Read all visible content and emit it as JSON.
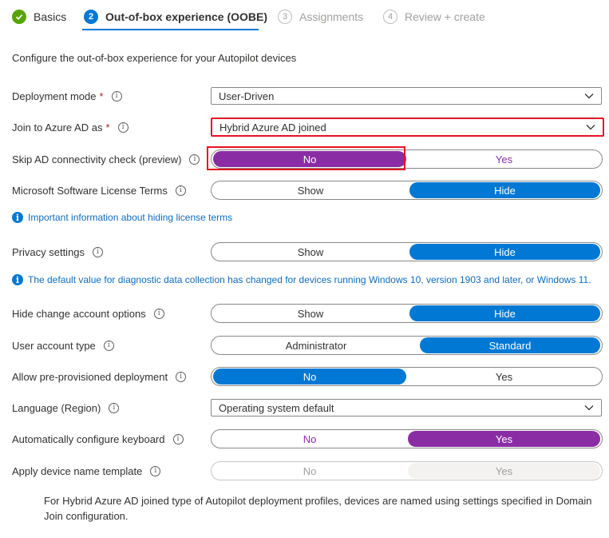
{
  "wizard": {
    "steps": [
      {
        "label": "Basics",
        "state": "done",
        "icon": "check-icon"
      },
      {
        "number": "2",
        "label": "Out-of-box experience (OOBE)",
        "state": "current"
      },
      {
        "number": "3",
        "label": "Assignments",
        "state": "todo"
      },
      {
        "number": "4",
        "label": "Review + create",
        "state": "todo"
      }
    ]
  },
  "intro": "Configure the out-of-box experience for your Autopilot devices",
  "fields": {
    "deployment_mode": {
      "label": "Deployment mode",
      "required": "*",
      "value": "User-Driven"
    },
    "join_azure": {
      "label": "Join to Azure AD as",
      "required": "*",
      "value": "Hybrid Azure AD joined"
    },
    "skip_ad": {
      "label": "Skip AD connectivity check (preview)",
      "options": [
        "No",
        "Yes"
      ],
      "selected": "No"
    },
    "license_terms": {
      "label": "Microsoft Software License Terms",
      "options": [
        "Show",
        "Hide"
      ],
      "selected": "Hide"
    },
    "license_notice": "Important information about hiding license terms",
    "privacy": {
      "label": "Privacy settings",
      "options": [
        "Show",
        "Hide"
      ],
      "selected": "Hide"
    },
    "privacy_notice": "The default value for diagnostic data collection has changed for devices running Windows 10, version 1903 and later, or Windows 11.",
    "change_account": {
      "label": "Hide change account options",
      "options": [
        "Show",
        "Hide"
      ],
      "selected": "Hide"
    },
    "account_type": {
      "label": "User account type",
      "options": [
        "Administrator",
        "Standard"
      ],
      "selected": "Standard"
    },
    "pre_provisioned": {
      "label": "Allow pre-provisioned deployment",
      "options": [
        "No",
        "Yes"
      ],
      "selected": "No"
    },
    "language": {
      "label": "Language (Region)",
      "value": "Operating system default"
    },
    "keyboard": {
      "label": "Automatically configure keyboard",
      "options": [
        "No",
        "Yes"
      ],
      "selected": "Yes"
    },
    "device_name": {
      "label": "Apply device name template",
      "options": [
        "No",
        "Yes"
      ],
      "selected": "Yes",
      "disabled": true
    }
  },
  "footnote": "For Hybrid Azure AD joined type of Autopilot deployment profiles, devices are named using settings specified in Domain Join configuration.",
  "colors": {
    "accent": "#0078d4",
    "purple": "#8a2da5",
    "highlight": "#e81123",
    "success": "#57a300"
  }
}
